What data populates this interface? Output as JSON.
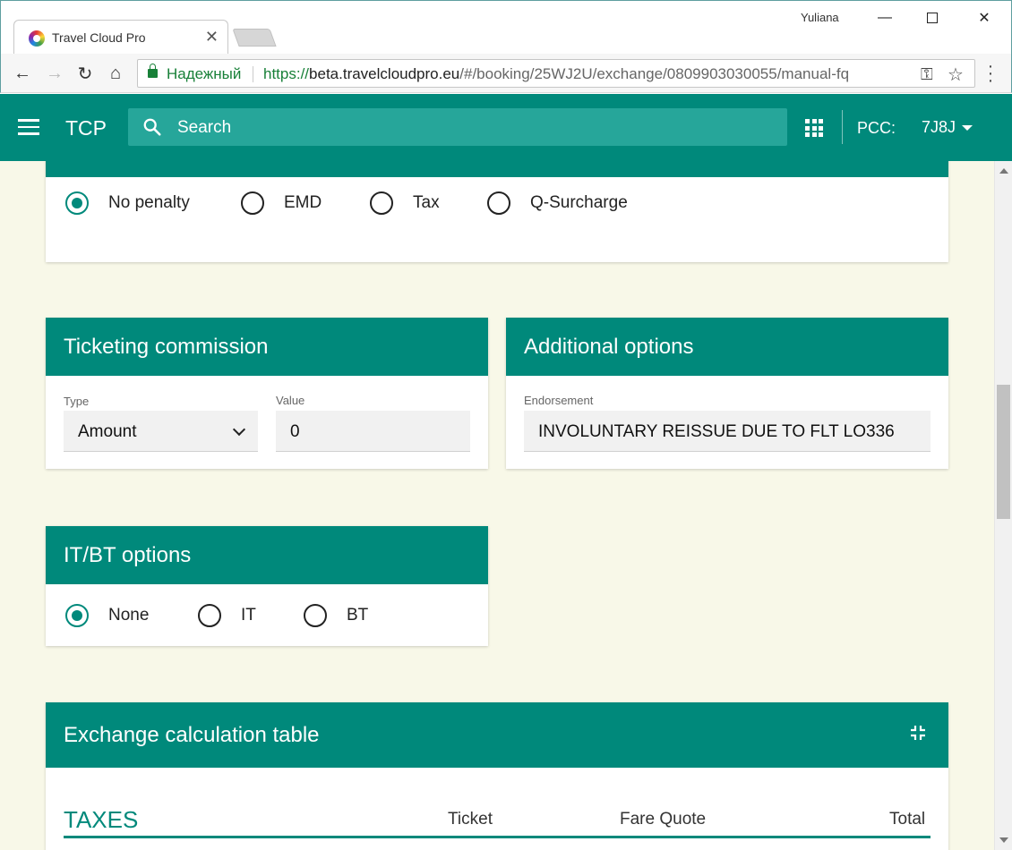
{
  "browser": {
    "tab_title": "Travel Cloud Pro",
    "user": "Yuliana",
    "secure_label": "Надежный",
    "url_scheme": "https://",
    "url_host": "beta.travelcloudpro.eu",
    "url_path": "/#/booking/25WJ2U/exchange/0809903030055/manual-fq"
  },
  "appbar": {
    "title": "TCP",
    "search_placeholder": "Search",
    "pcc_label": "PCC:",
    "pcc_value": "7J8J"
  },
  "penalty": {
    "options": [
      {
        "label": "No penalty",
        "checked": true
      },
      {
        "label": "EMD",
        "checked": false
      },
      {
        "label": "Tax",
        "checked": false
      },
      {
        "label": "Q-Surcharge",
        "checked": false
      }
    ]
  },
  "ticketing_commission": {
    "title": "Ticketing commission",
    "type_label": "Type",
    "type_value": "Amount",
    "value_label": "Value",
    "value_value": "0"
  },
  "additional_options": {
    "title": "Additional options",
    "endorsement_label": "Endorsement",
    "endorsement_value": "INVOLUNTARY REISSUE DUE TO FLT LO336"
  },
  "itbt": {
    "title": "IT/BT options",
    "options": [
      {
        "label": "None",
        "checked": true
      },
      {
        "label": "IT",
        "checked": false
      },
      {
        "label": "BT",
        "checked": false
      }
    ]
  },
  "exchange_table": {
    "title": "Exchange calculation table",
    "section_title": "TAXES",
    "columns": [
      "Ticket",
      "Fare Quote",
      "Total"
    ]
  },
  "colors": {
    "primary": "#00897b",
    "search_bg": "#26a69a",
    "page_bg": "#f8f8e8"
  }
}
